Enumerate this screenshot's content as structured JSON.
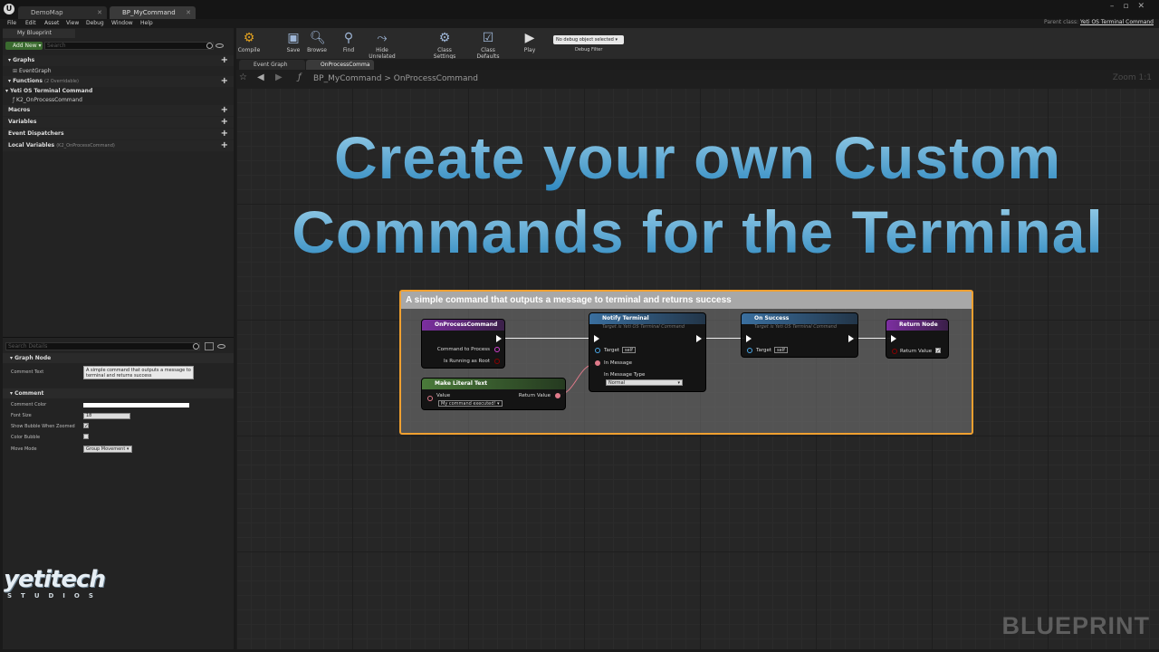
{
  "window": {
    "tabs": [
      {
        "label": "DemoMap"
      },
      {
        "label": "BP_MyCommand"
      }
    ],
    "parent_class_label": "Parent class:",
    "parent_class_value": "Yeti OS Terminal Command"
  },
  "menu": [
    "File",
    "Edit",
    "Asset",
    "View",
    "Debug",
    "Window",
    "Help"
  ],
  "my_blueprint": {
    "tab_label": "My Blueprint",
    "add_new_label": "Add New",
    "search_placeholder": "Search",
    "sections": {
      "graphs": "Graphs",
      "event_graph": "EventGraph",
      "functions": "Functions",
      "functions_sub": "(2 Overridable)",
      "category": "Yeti OS Terminal Command",
      "function_item": "K2_OnProcessCommand",
      "macros": "Macros",
      "variables": "Variables",
      "event_dispatchers": "Event Dispatchers",
      "local_variables": "Local Variables",
      "local_variables_sub": "(K2_OnProcessCommand)"
    }
  },
  "details": {
    "search_placeholder": "Search Details",
    "graph_node_header": "Graph Node",
    "comment_text_label": "Comment Text",
    "comment_text_value": "A simple command that outputs a message to terminal and returns success",
    "comment_header": "Comment",
    "comment_color_label": "Comment Color",
    "comment_color": "#ffffff",
    "font_size_label": "Font Size",
    "font_size_value": "18",
    "show_bubble_label": "Show Bubble When Zoomed",
    "show_bubble_checked": true,
    "color_bubble_label": "Color Bubble",
    "color_bubble_checked": false,
    "move_mode_label": "Move Mode",
    "move_mode_value": "Group Movement"
  },
  "toolbar": {
    "compile": "Compile",
    "save": "Save",
    "browse": "Browse",
    "find": "Find",
    "hide_unrelated": "Hide Unrelated",
    "class_settings": "Class Settings",
    "class_defaults": "Class Defaults",
    "play": "Play",
    "debug_object": "No debug object selected",
    "debug_filter": "Debug Filter"
  },
  "graph_tabs": [
    {
      "label": "Event Graph"
    },
    {
      "label": "OnProcessComma"
    }
  ],
  "breadcrumb": {
    "root": "BP_MyCommand",
    "separator": ">",
    "leaf": "OnProcessCommand"
  },
  "zoom_label": "Zoom 1:1",
  "headline": {
    "line1": "Create your own Custom",
    "line2": "Commands for the Terminal"
  },
  "comment_box": {
    "title": "A simple command that outputs a message to terminal and returns success",
    "border_color": "#f0a030"
  },
  "nodes": {
    "entry": {
      "title": "OnProcessCommand",
      "pin_command": "Command to Process",
      "pin_root": "Is Running as Root"
    },
    "literal": {
      "title": "Make Literal Text",
      "pin_value": "Value",
      "value_text": "My command executed!",
      "pin_return": "Return Value"
    },
    "notify": {
      "title": "Notify Terminal",
      "subtitle": "Target is Yeti OS Terminal Command",
      "pin_target": "Target",
      "self": "self",
      "pin_message": "In Message",
      "pin_type": "In Message Type",
      "type_value": "Normal"
    },
    "success": {
      "title": "On Success",
      "subtitle": "Target is Yeti OS Terminal Command",
      "pin_target": "Target",
      "self": "self"
    },
    "return": {
      "title": "Return Node",
      "pin_return": "Return Value"
    }
  },
  "logo": {
    "main": "yetitech",
    "sub": "STUDIOS"
  },
  "watermark": "BLUEPRINT"
}
